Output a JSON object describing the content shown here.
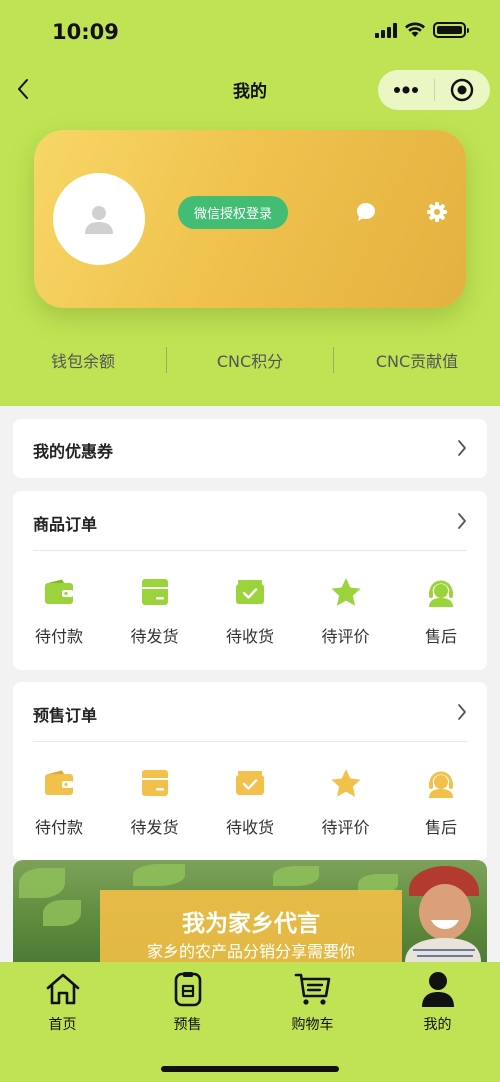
{
  "status_bar": {
    "time": "10:09"
  },
  "nav": {
    "title": "我的"
  },
  "profile": {
    "login_label": "微信授权登录"
  },
  "stats": [
    {
      "label": "钱包余额"
    },
    {
      "label": "CNC积分"
    },
    {
      "label": "CNC贡献值"
    }
  ],
  "coupon": {
    "title": "我的优惠券"
  },
  "goods_orders": {
    "title": "商品订单",
    "items": [
      {
        "label": "待付款",
        "icon": "wallet-icon"
      },
      {
        "label": "待发货",
        "icon": "package-icon"
      },
      {
        "label": "待收货",
        "icon": "receive-box-icon"
      },
      {
        "label": "待评价",
        "icon": "star-icon"
      },
      {
        "label": "售后",
        "icon": "headset-icon"
      }
    ]
  },
  "presale_orders": {
    "title": "预售订单",
    "items": [
      {
        "label": "待付款",
        "icon": "wallet-icon"
      },
      {
        "label": "待发货",
        "icon": "package-icon"
      },
      {
        "label": "待收货",
        "icon": "receive-box-icon"
      },
      {
        "label": "待评价",
        "icon": "star-icon"
      },
      {
        "label": "售后",
        "icon": "headset-icon"
      }
    ]
  },
  "banner": {
    "title": "我为家乡代言",
    "subtitle": "家乡的农产品分销分享需要你"
  },
  "tabbar": {
    "items": [
      {
        "label": "首页",
        "icon": "home-icon"
      },
      {
        "label": "预售",
        "icon": "presale-icon"
      },
      {
        "label": "购物车",
        "icon": "cart-icon"
      },
      {
        "label": "我的",
        "icon": "user-icon"
      }
    ]
  },
  "colors": {
    "theme_green": "#bfe354",
    "card_gold": "#f0c24e",
    "wechat_green": "#43bd73",
    "goods_icon_green": "#9bd33c",
    "presale_icon_gold": "#f2c14b"
  }
}
